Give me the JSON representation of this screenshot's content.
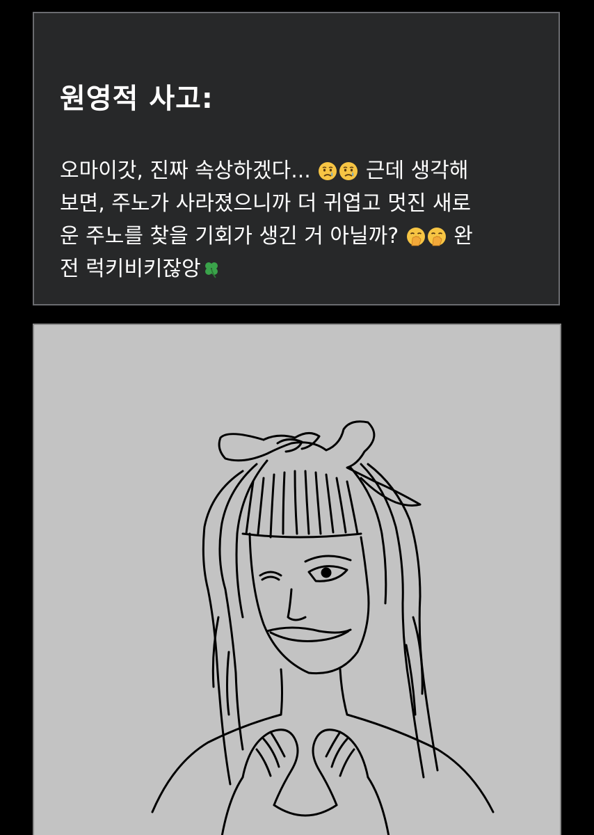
{
  "card": {
    "title": "원영적 사고:",
    "body": {
      "line1_a": "오마이갓, 진짜 속상하겠다...",
      "line1_b": "근데 생각해",
      "line2": "보면, 주노가 사라졌으니까 더 귀엽고 멋진 새로",
      "line3_a": "운 주노를 찾을 기회가 생긴 거 아닐까?",
      "line3_b": "완",
      "line4": "전 럭키비키잖앙"
    },
    "emojis": [
      "crying-face-icon",
      "crying-face-icon",
      "hand-over-mouth-icon",
      "hand-over-mouth-icon",
      "four-leaf-clover-icon"
    ]
  },
  "colors": {
    "page_background": "#000000",
    "card_background": "#272829",
    "card_border": "#6b6c70",
    "text": "#ffffff",
    "drawing_background": "#c3c3c3",
    "drawing_ink": "#000000"
  },
  "drawing": {
    "subject": "line-drawing-of-girl-winking-with-hand-heart"
  }
}
